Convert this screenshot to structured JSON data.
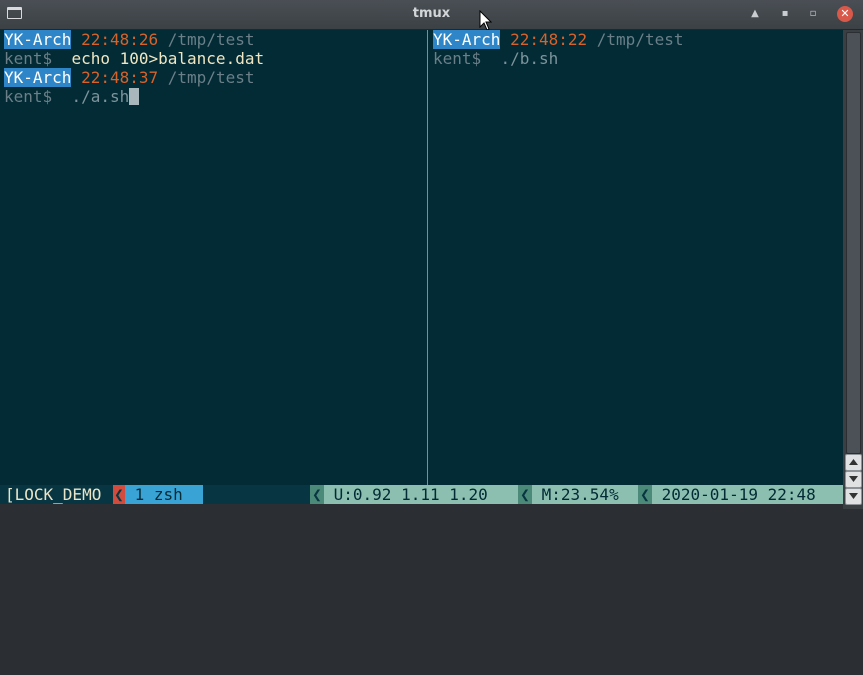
{
  "window": {
    "title": "tmux",
    "buttons": {
      "shade": "▲",
      "minimize": "▪",
      "maximize": "▫",
      "close": "✕"
    }
  },
  "left_pane": {
    "lines": [
      {
        "host": "YK-Arch",
        "time": "22:48:26",
        "path": "/tmp/test"
      },
      {
        "user": "kent$",
        "command": "echo 100>balance.dat"
      },
      {
        "host": "YK-Arch",
        "time": "22:48:37",
        "path": "/tmp/test"
      },
      {
        "user": "kent$",
        "command": "./a.sh"
      }
    ]
  },
  "right_pane": {
    "lines": [
      {
        "host": "YK-Arch",
        "time": "22:48:22",
        "path": "/tmp/test"
      },
      {
        "user": "kent$",
        "command": "./b.sh"
      }
    ]
  },
  "status_bar": {
    "session": "[LOCK_DEMO",
    "separator": "❮",
    "window": " 1 zsh",
    "uptime": " U:0.92 1.11 1.20 ",
    "memory": " M:23.54% ",
    "datetime": " 2020-01-19 22:48"
  },
  "colors": {
    "terminal_bg": "#022b35",
    "host_bg": "#2e86c8",
    "time": "#d7622a",
    "path": "#6b7f88",
    "status_bg": "#073642",
    "window_tab": "#39a3d6",
    "status_segments": "#8cbfb0",
    "session_separator": "#d24b3c"
  },
  "scrollbar": {
    "up_icon": "arrow-up-icon",
    "down_icon": "arrow-down-icon"
  }
}
